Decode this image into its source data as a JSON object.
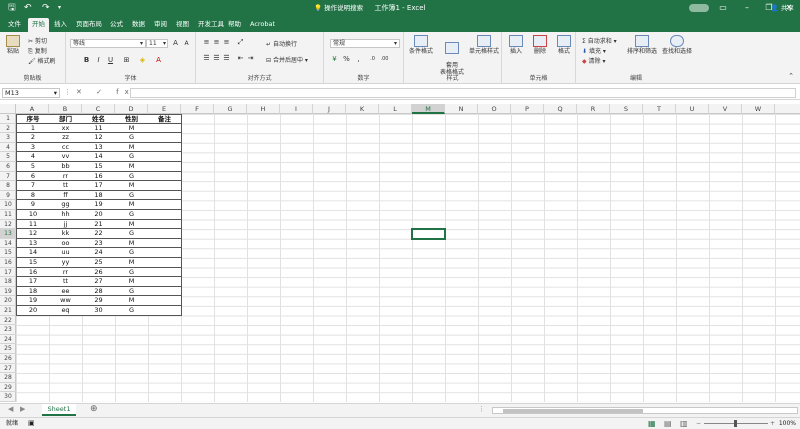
{
  "titlebar": {
    "title": "工作簿1 - Excel",
    "save_icon": "save-icon",
    "undo_icon": "undo-icon",
    "redo_icon": "redo-icon",
    "customize_icon": "chevron-down-icon"
  },
  "tabs": [
    "文件",
    "开始",
    "插入",
    "页面布局",
    "公式",
    "数据",
    "审阅",
    "视图",
    "开发工具",
    "帮助",
    "Acrobat"
  ],
  "active_tab": "开始",
  "tellme": "操作说明搜索",
  "share": "共享",
  "ribbon": {
    "clipboard": {
      "paste": "粘贴",
      "cut": "剪切",
      "copy": "复制",
      "format_painter": "格式刷",
      "label": "剪贴板"
    },
    "font": {
      "name": "等线",
      "size": "11",
      "bold": "B",
      "italic": "I",
      "underline": "U",
      "grow": "A",
      "shrink": "A",
      "label": "字体"
    },
    "alignment": {
      "wrap": "自动换行",
      "merge": "合并后居中",
      "label": "对齐方式"
    },
    "number": {
      "format": "常规",
      "percent": "%",
      "comma": ",",
      "label": "数字"
    },
    "styles": {
      "conditional": "条件格式",
      "table": "套用\n表格格式",
      "cell_styles": "单元格样式",
      "label": "样式"
    },
    "cells": {
      "insert": "插入",
      "delete": "删除",
      "format": "格式",
      "label": "单元格"
    },
    "editing": {
      "autosum": "自动求和",
      "fill": "填充",
      "clear": "清除",
      "sort": "排序和筛选",
      "find": "查找和选择",
      "label": "编辑"
    }
  },
  "formula_bar": {
    "name_box": "M13",
    "fx": "✕ ✓ fx",
    "value": ""
  },
  "columns": [
    "A",
    "B",
    "C",
    "D",
    "E",
    "F",
    "G",
    "H",
    "I",
    "J",
    "K",
    "L",
    "M",
    "N",
    "O",
    "P",
    "Q",
    "R",
    "S",
    "T",
    "U",
    "V",
    "W"
  ],
  "selected_column": "M",
  "selected_row": 13,
  "rows": 30,
  "table": {
    "headers": [
      "序号",
      "部门",
      "姓名",
      "性别",
      "备注"
    ],
    "data": [
      [
        "1",
        "xx",
        "11",
        "M",
        ""
      ],
      [
        "2",
        "zz",
        "12",
        "G",
        ""
      ],
      [
        "3",
        "cc",
        "13",
        "M",
        ""
      ],
      [
        "4",
        "vv",
        "14",
        "G",
        ""
      ],
      [
        "5",
        "bb",
        "15",
        "M",
        ""
      ],
      [
        "6",
        "rr",
        "16",
        "G",
        ""
      ],
      [
        "7",
        "tt",
        "17",
        "M",
        ""
      ],
      [
        "8",
        "ff",
        "18",
        "G",
        ""
      ],
      [
        "9",
        "gg",
        "19",
        "M",
        ""
      ],
      [
        "10",
        "hh",
        "20",
        "G",
        ""
      ],
      [
        "11",
        "jj",
        "21",
        "M",
        ""
      ],
      [
        "12",
        "kk",
        "22",
        "G",
        ""
      ],
      [
        "13",
        "oo",
        "23",
        "M",
        ""
      ],
      [
        "14",
        "uu",
        "24",
        "G",
        ""
      ],
      [
        "15",
        "yy",
        "25",
        "M",
        ""
      ],
      [
        "16",
        "rr",
        "26",
        "G",
        ""
      ],
      [
        "17",
        "tt",
        "27",
        "M",
        ""
      ],
      [
        "18",
        "ee",
        "28",
        "G",
        ""
      ],
      [
        "19",
        "ww",
        "29",
        "M",
        ""
      ],
      [
        "20",
        "eq",
        "30",
        "G",
        ""
      ]
    ]
  },
  "sheets": [
    "Sheet1"
  ],
  "status": {
    "ready": "就绪",
    "zoom": "100%"
  }
}
